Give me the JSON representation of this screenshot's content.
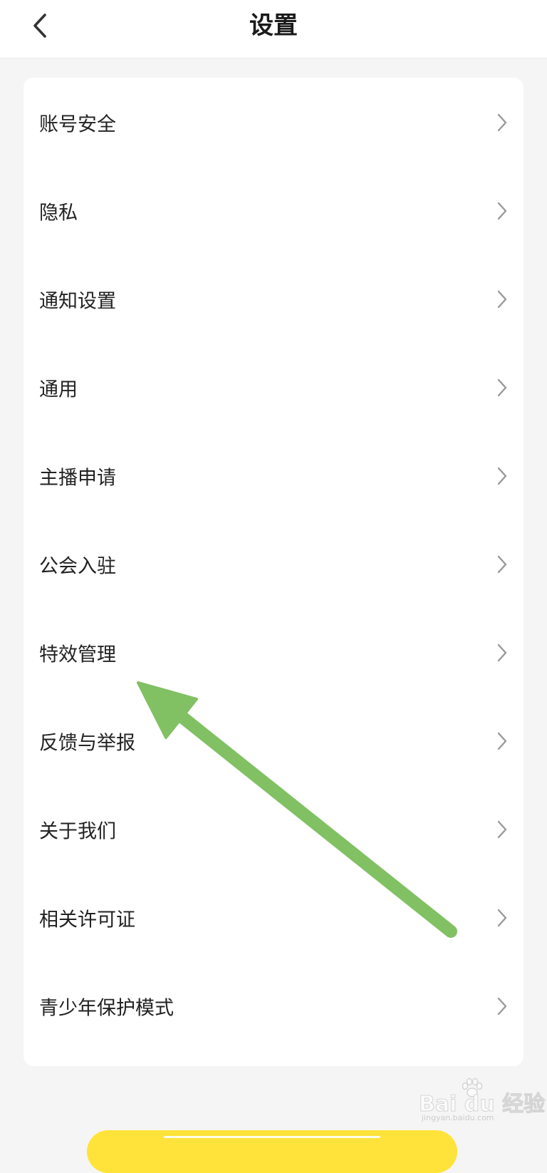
{
  "header": {
    "title": "设置",
    "back_icon": "chevron-left-icon"
  },
  "menu": {
    "items": [
      {
        "label": "账号安全",
        "icon": "chevron-right-icon"
      },
      {
        "label": "隐私",
        "icon": "chevron-right-icon"
      },
      {
        "label": "通知设置",
        "icon": "chevron-right-icon"
      },
      {
        "label": "通用",
        "icon": "chevron-right-icon"
      },
      {
        "label": "主播申请",
        "icon": "chevron-right-icon"
      },
      {
        "label": "公会入驻",
        "icon": "chevron-right-icon"
      },
      {
        "label": "特效管理",
        "icon": "chevron-right-icon"
      },
      {
        "label": "反馈与举报",
        "icon": "chevron-right-icon"
      },
      {
        "label": "关于我们",
        "icon": "chevron-right-icon"
      },
      {
        "label": "相关许可证",
        "icon": "chevron-right-icon"
      },
      {
        "label": "青少年保护模式",
        "icon": "chevron-right-icon"
      }
    ]
  },
  "annotation": {
    "type": "arrow",
    "color": "#82c064",
    "points_to": "特效管理"
  },
  "watermark": {
    "text": "Bai du 经验",
    "subtext": "jingyan.baidu.com"
  },
  "colors": {
    "background": "#f5f5f5",
    "card": "#ffffff",
    "bottom_bar": "#ffe33a",
    "chevron": "#999999"
  }
}
